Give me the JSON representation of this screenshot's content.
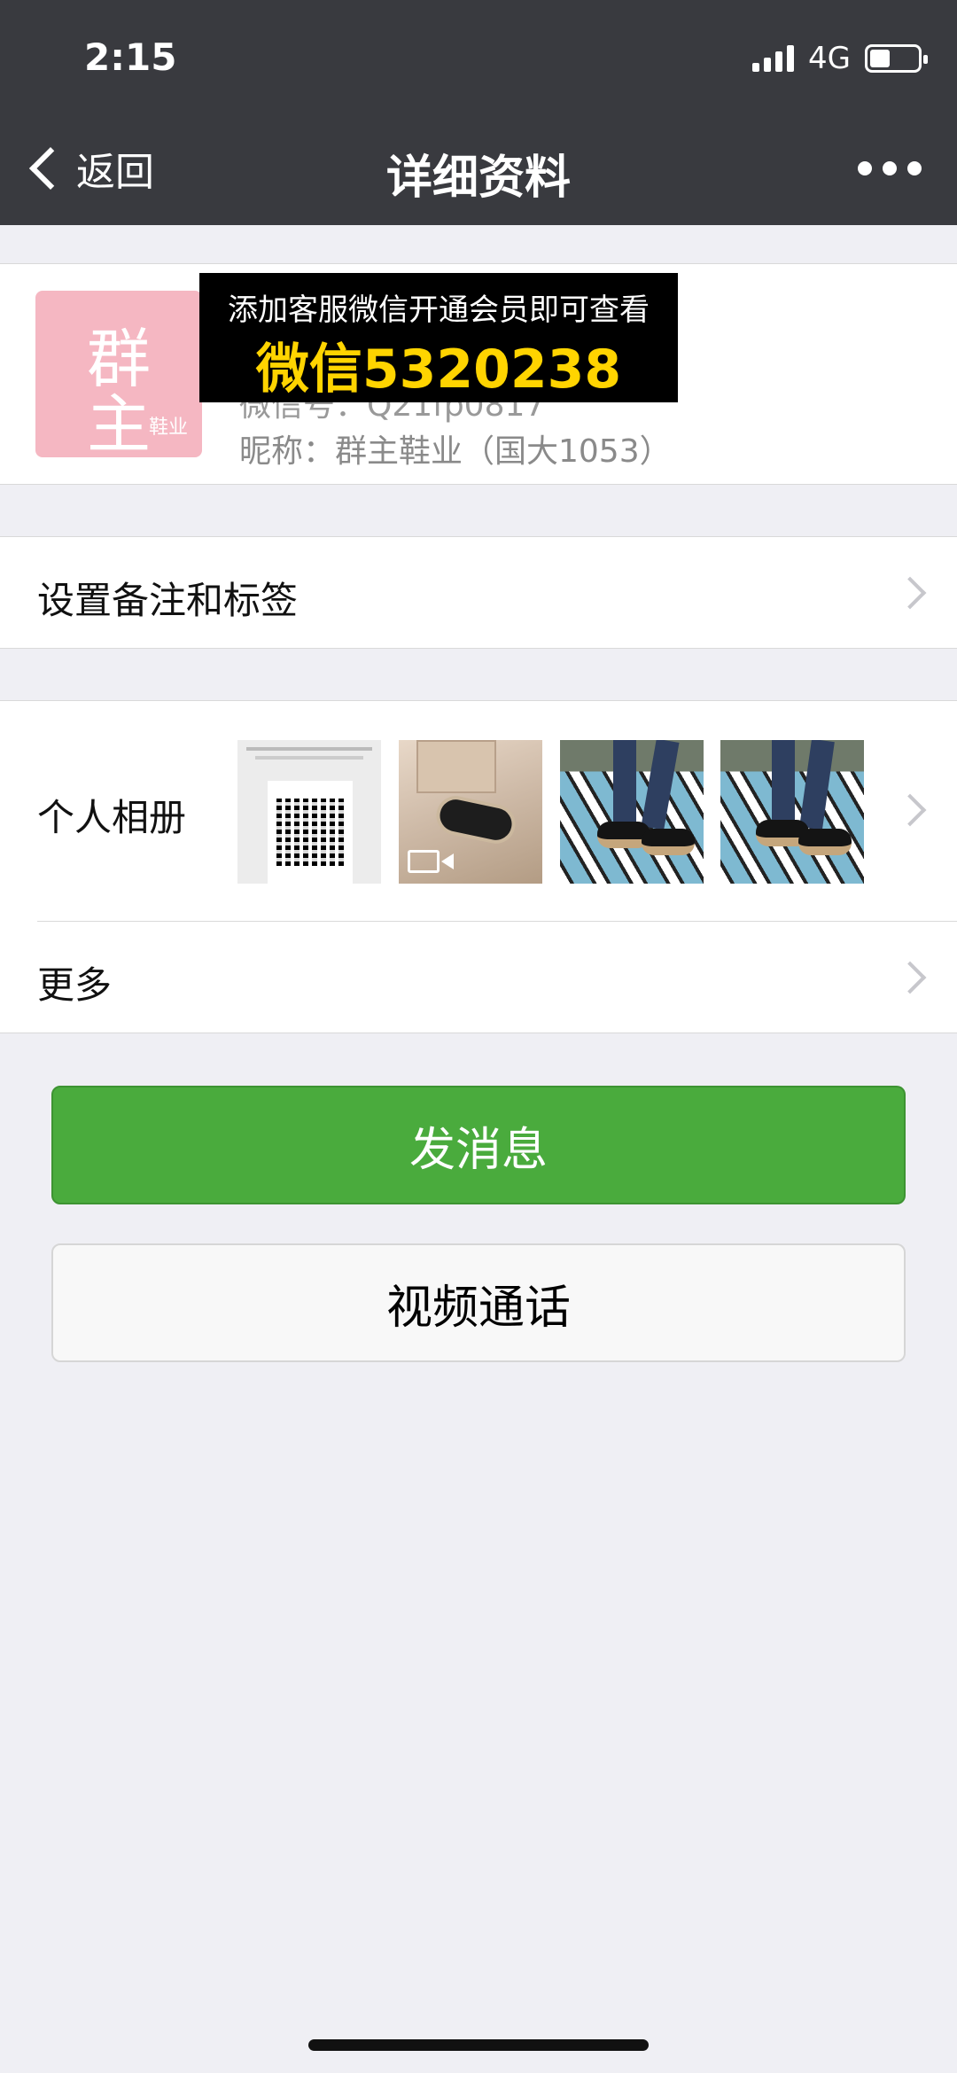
{
  "status": {
    "time": "2:15",
    "network": "4G"
  },
  "nav": {
    "back_label": "返回",
    "title": "详细资料"
  },
  "profile": {
    "avatar_text_1": "群",
    "avatar_text_2": "主",
    "avatar_small": "鞋业",
    "wechat_id": "微信号：Q21fp0817",
    "nickname": "昵称：群主鞋业（国大1053）"
  },
  "overlay_ad": {
    "line1": "添加客服微信开通会员即可查看",
    "line2": "微信5320238"
  },
  "cells": {
    "remark": "设置备注和标签",
    "album": "个人相册",
    "more": "更多"
  },
  "buttons": {
    "send": "发消息",
    "video": "视频通话"
  },
  "colors": {
    "nav_bg": "#393a3f",
    "primary": "#4aab3d",
    "ad_text": "#ffd400"
  }
}
